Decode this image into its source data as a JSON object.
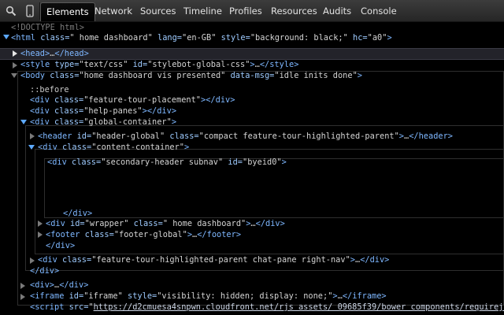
{
  "toolbar": {
    "search_icon": "search-icon",
    "device_icon": "device-mode-icon",
    "tabs": [
      {
        "label": "Elements",
        "active": true
      },
      {
        "label": "Network"
      },
      {
        "label": "Sources"
      },
      {
        "label": "Timeline"
      },
      {
        "label": "Profiles"
      },
      {
        "label": "Resources"
      },
      {
        "label": "Audits"
      },
      {
        "label": "Console"
      }
    ]
  },
  "dom": {
    "doctype": "<!DOCTYPE html>",
    "html_open": {
      "tag": "<html",
      "a1": " class=",
      "v1": "\" home dashboard\"",
      "a2": " lang=",
      "v2": "\"en-GB\"",
      "a3": " style=",
      "v3": "\"background: black;\"",
      "a4": " hc=",
      "v4": "\"a0\"",
      "end": ">"
    },
    "head": {
      "open": "<head>",
      "dots": "…",
      "close": "</head>"
    },
    "style": {
      "tag": "<style",
      "a1": " type=",
      "v1": "\"text/css\"",
      "a2": " id=",
      "v2": "\"stylebot-global-css\"",
      "end": ">",
      "dots": "…",
      "close": "</style>"
    },
    "body_open": {
      "tag": "<body",
      "a1": " class=",
      "v1": "\"home dashboard vis presented\"",
      "a2": " data-msg=",
      "v2": "\"idle inits done\"",
      "end": ">"
    },
    "before": "::before",
    "ft_placement": {
      "tag": "<div",
      "a1": " class=",
      "v1": "\"feature-tour-placement\"",
      "end": ">",
      "close": "</div>"
    },
    "help_panes": {
      "tag": "<div",
      "a1": " class=",
      "v1": "\"help-panes\"",
      "end": ">",
      "close": "</div>"
    },
    "global_container": {
      "tag": "<div",
      "a1": " class=",
      "v1": "\"global-container\"",
      "end": ">"
    },
    "header": {
      "tag": "<header",
      "a1": " id=",
      "v1": "\"header-global\"",
      "a2": " class=",
      "v2": "\"compact feature-tour-highlighted-parent\"",
      "end": ">",
      "dots": "…",
      "close": "</header>"
    },
    "content_container": {
      "tag": "<div",
      "a1": " class=",
      "v1": "\"content-container\"",
      "end": ">"
    },
    "secondary_header": {
      "tag": "<div",
      "a1": " class=",
      "v1": "\"secondary-header subnav\"",
      "a2": " id=",
      "v2": "\"byeid0\"",
      "end": ">"
    },
    "div_close_1": "</div>",
    "wrapper": {
      "tag": "<div",
      "a1": " id=",
      "v1": "\"wrapper\"",
      "a2": " class=",
      "v2": "\" home dashboard\"",
      "end": ">",
      "dots": "…",
      "close": "</div>"
    },
    "footer": {
      "tag": "<footer",
      "a1": " class=",
      "v1": "\"footer-global\"",
      "end": ">",
      "dots": "…",
      "close": "</footer>"
    },
    "div_close_2": "</div>",
    "chat_pane": {
      "tag": "<div",
      "a1": " class=",
      "v1": "\"feature-tour-highlighted-parent chat-pane right-nav\"",
      "end": ">",
      "dots": "…",
      "close": "</div>"
    },
    "div_close_3": "</div>",
    "div_collapsed": {
      "open": "<div>",
      "dots": "…",
      "close": "</div>"
    },
    "iframe": {
      "tag": "<iframe",
      "a1": " id=",
      "v1": "\"iframe\"",
      "a2": " style=",
      "v2": "\"visibility: hidden; display: none;\"",
      "end": ">",
      "dots": "…",
      "close": "</iframe>"
    },
    "script": {
      "tag": "<script",
      "a1": " src=",
      "q": "\"",
      "url": "https://d2cmuesa4snpwn.cloudfront.net/rjs assets/ 09685f39/bower components/requirejs/"
    }
  }
}
